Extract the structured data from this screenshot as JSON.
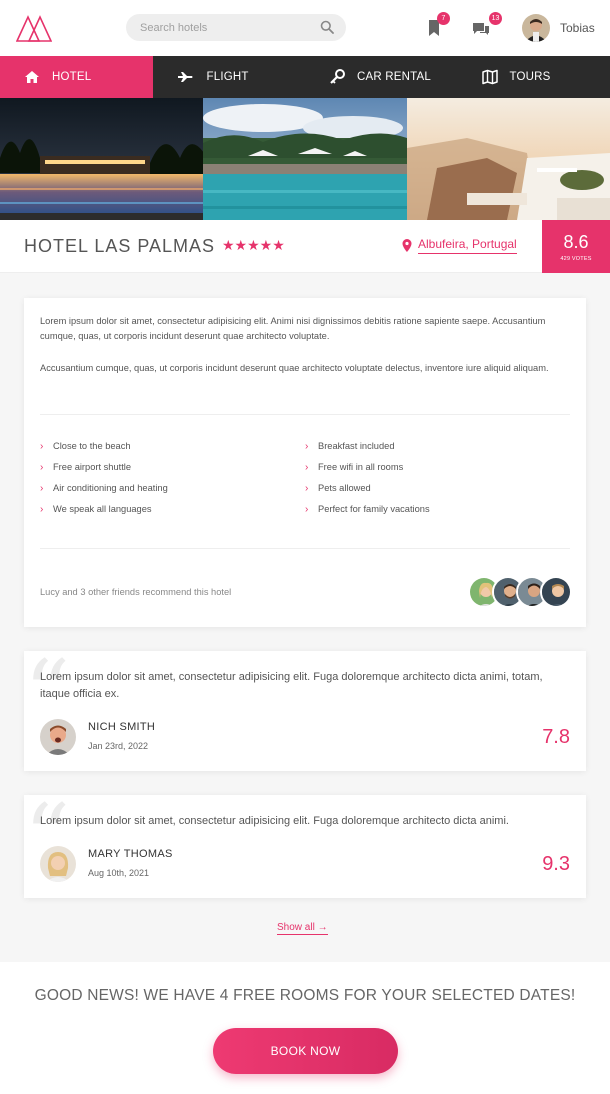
{
  "header": {
    "search": {
      "placeholder": "Search hotels"
    },
    "bookmarks_badge": "7",
    "messages_badge": "13",
    "user_name": "Tobias"
  },
  "nav": {
    "items": [
      {
        "label": "HOTEL",
        "icon": "home-icon",
        "active": true
      },
      {
        "label": "FLIGHT",
        "icon": "plane-icon",
        "active": false
      },
      {
        "label": "CAR RENTAL",
        "icon": "key-icon",
        "active": false
      },
      {
        "label": "TOURS",
        "icon": "map-icon",
        "active": false
      }
    ]
  },
  "hotel": {
    "name": "HOTEL LAS PALMAS",
    "stars": "★★★★★",
    "location": "Albufeira, Portugal",
    "rating": "8.6",
    "votes": "429 VOTES"
  },
  "description": {
    "paragraph_1": "Lorem ipsum dolor sit amet, consectetur adipisicing elit. Animi nisi dignissimos debitis ratione sapiente saepe. Accusantium cumque, quas, ut corporis incidunt deserunt quae architecto voluptate.",
    "paragraph_2": "Accusantium cumque, quas, ut corporis incidunt deserunt quae architecto voluptate delectus, inventore iure aliquid aliquam.",
    "amenities_left": [
      "Close to the beach",
      "Free airport shuttle",
      "Air conditioning and heating",
      "We speak all languages"
    ],
    "amenities_right": [
      "Breakfast included",
      "Free wifi in all rooms",
      "Pets allowed",
      "Perfect for family vacations"
    ],
    "recommend": "Lucy and 3 other friends recommend this hotel"
  },
  "reviews": [
    {
      "text": "Lorem ipsum dolor sit amet, consectetur adipisicing elit. Fuga doloremque architecto dicta animi, totam, itaque officia ex.",
      "name": "NICH SMITH",
      "date": "Jan 23rd, 2022",
      "score": "7.8"
    },
    {
      "text": "Lorem ipsum dolor sit amet, consectetur adipisicing elit. Fuga doloremque architecto dicta animi.",
      "name": "MARY THOMAS",
      "date": "Aug 10th, 2021",
      "score": "9.3"
    }
  ],
  "show_all": "Show all →",
  "bottom": {
    "good_news": "GOOD NEWS! WE HAVE 4 FREE ROOMS FOR YOUR SELECTED DATES!",
    "book_now": "BOOK NOW"
  },
  "colors": {
    "accent": "#e6336b",
    "nav_bg": "#2b2b2b"
  }
}
